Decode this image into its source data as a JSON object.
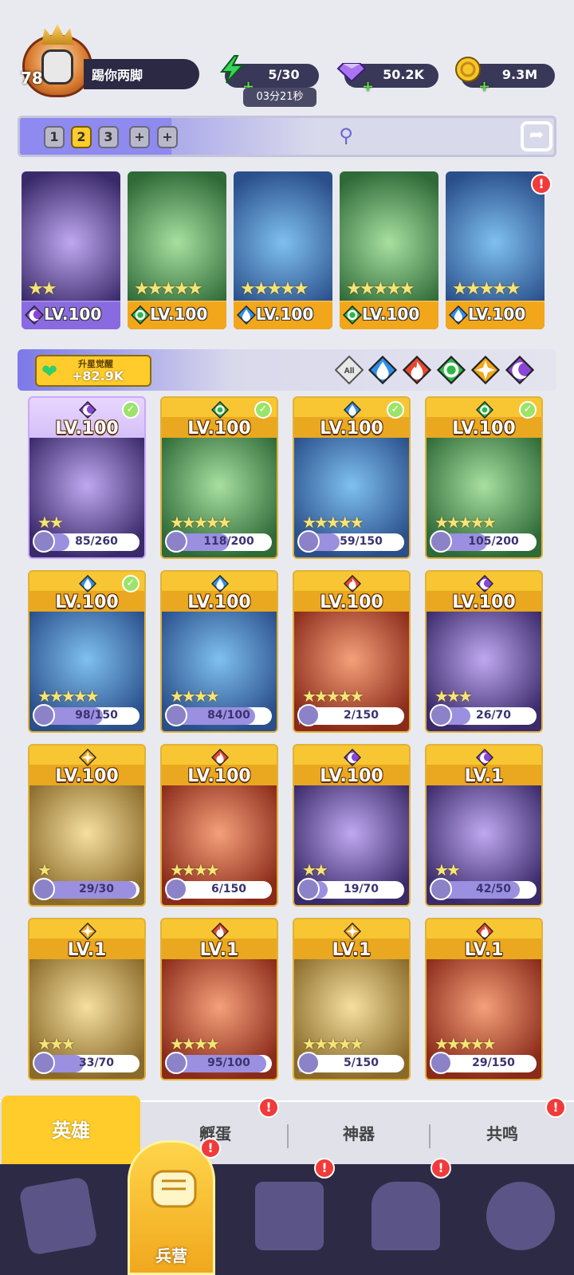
{
  "player": {
    "level": "78",
    "name": "踢你两脚"
  },
  "resources": {
    "energy": "5/30",
    "timer": "03分21秒",
    "gems": "50.2K",
    "gold": "9.3M"
  },
  "team_tabs": [
    "1",
    "2",
    "3",
    "+",
    "+"
  ],
  "team_tab_selected": "2",
  "team": [
    {
      "level": "LV.100",
      "element": "dark",
      "stars": 2
    },
    {
      "level": "LV.100",
      "element": "wind",
      "stars": 5
    },
    {
      "level": "LV.100",
      "element": "water",
      "stars": 5
    },
    {
      "level": "LV.100",
      "element": "wind",
      "stars": 5
    },
    {
      "level": "LV.100",
      "element": "water",
      "stars": 5
    }
  ],
  "awaken": {
    "label": "升星觉醒",
    "value": "+82.9K"
  },
  "filters": {
    "all_label": "All",
    "elements": [
      "water",
      "fire",
      "wind",
      "light",
      "dark"
    ]
  },
  "heroes": [
    {
      "level": "LV.100",
      "element": "dark",
      "check": true,
      "stars": 2,
      "progress": "85/260",
      "frac": 0.33,
      "theme": "purple"
    },
    {
      "level": "LV.100",
      "element": "wind",
      "check": true,
      "stars": 5,
      "progress": "118/200",
      "frac": 0.59,
      "theme": "gold"
    },
    {
      "level": "LV.100",
      "element": "water",
      "check": true,
      "stars": 5,
      "progress": "59/150",
      "frac": 0.39,
      "theme": "gold"
    },
    {
      "level": "LV.100",
      "element": "wind",
      "check": true,
      "stars": 5,
      "progress": "105/200",
      "frac": 0.53,
      "theme": "gold"
    },
    {
      "level": "LV.100",
      "element": "water",
      "check": true,
      "stars": 5,
      "progress": "98/150",
      "frac": 0.65,
      "theme": "gold"
    },
    {
      "level": "LV.100",
      "element": "water",
      "check": false,
      "stars": 4,
      "progress": "84/100",
      "frac": 0.84,
      "theme": "gold"
    },
    {
      "level": "LV.100",
      "element": "fire",
      "check": false,
      "stars": 5,
      "progress": "2/150",
      "frac": 0.01,
      "theme": "gold"
    },
    {
      "level": "LV.100",
      "element": "dark",
      "check": false,
      "stars": 3,
      "progress": "26/70",
      "frac": 0.37,
      "theme": "gold"
    },
    {
      "level": "LV.100",
      "element": "light",
      "check": false,
      "stars": 1,
      "progress": "29/30",
      "frac": 0.97,
      "theme": "gold"
    },
    {
      "level": "LV.100",
      "element": "fire",
      "check": false,
      "stars": 4,
      "progress": "6/150",
      "frac": 0.04,
      "theme": "gold"
    },
    {
      "level": "LV.100",
      "element": "dark",
      "check": false,
      "stars": 2,
      "progress": "19/70",
      "frac": 0.27,
      "theme": "gold"
    },
    {
      "level": "LV.1",
      "element": "dark",
      "check": false,
      "stars": 2,
      "progress": "42/50",
      "frac": 0.84,
      "theme": "gold"
    },
    {
      "level": "LV.1",
      "element": "light",
      "check": false,
      "stars": 3,
      "progress": "33/70",
      "frac": 0.47,
      "theme": "gold"
    },
    {
      "level": "LV.1",
      "element": "fire",
      "check": false,
      "stars": 4,
      "progress": "95/100",
      "frac": 0.95,
      "theme": "gold"
    },
    {
      "level": "LV.1",
      "element": "light",
      "check": false,
      "stars": 5,
      "progress": "5/150",
      "frac": 0.03,
      "theme": "gold"
    },
    {
      "level": "LV.1",
      "element": "fire",
      "check": false,
      "stars": 5,
      "progress": "29/150",
      "frac": 0.19,
      "theme": "gold"
    }
  ],
  "subtabs": [
    {
      "label": "英雄",
      "badge": false
    },
    {
      "label": "孵蛋",
      "badge": true
    },
    {
      "label": "神器",
      "badge": false
    },
    {
      "label": "共鸣",
      "badge": true
    }
  ],
  "nav": {
    "selected_label": "兵营",
    "badges": [
      "barracks",
      "map",
      "castle"
    ]
  },
  "element_colors": {
    "water": "#2f8fe8",
    "fire": "#e8462f",
    "wind": "#2fb84a",
    "light": "#f2a61a",
    "dark": "#8a45d8"
  }
}
